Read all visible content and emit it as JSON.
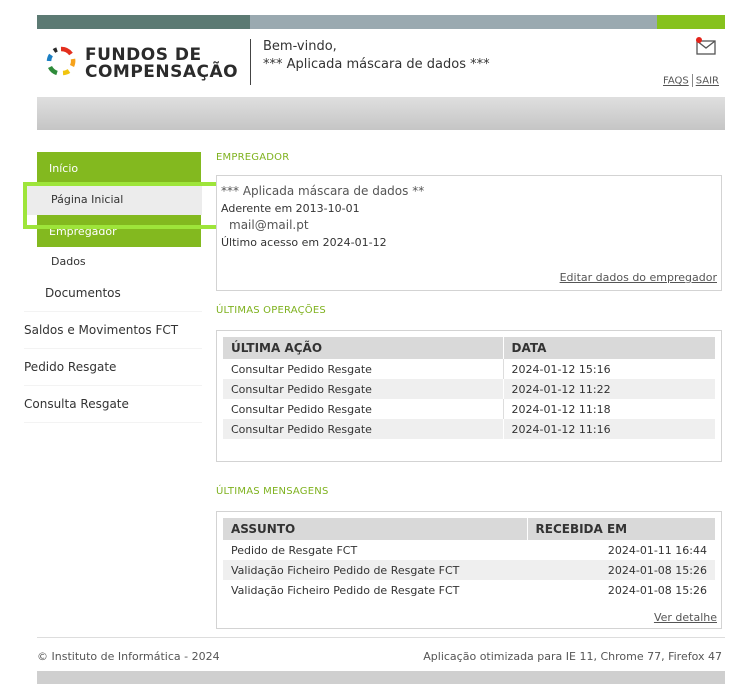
{
  "header": {
    "logo_line1": "FUNDOS DE",
    "logo_line2": "COMPENSAÇÃO",
    "welcome": "Bem-vindo,",
    "user": "*** Aplicada máscara de dados ***",
    "faqs": "FAQS",
    "sair": "SAIR"
  },
  "sidebar": {
    "section1": "Início",
    "pagina_inicial": "Página Inicial",
    "section2": "Empregador",
    "dados": "Dados",
    "items": [
      "Documentos",
      "Saldos e Movimentos FCT",
      "Pedido Resgate",
      "Consulta Resgate"
    ]
  },
  "empregador": {
    "title": "EMPREGADOR",
    "name": "*** Aplicada máscara de dados **",
    "aderente": "Aderente em 2013-10-01",
    "email": "mail@mail.pt",
    "ultimo_acesso": "Último acesso em 2024-01-12",
    "edit_link": "Editar dados do empregador"
  },
  "operacoes": {
    "title": "ÚLTIMAS OPERAÇÕES",
    "col1": "ÚLTIMA AÇÃO",
    "col2": "DATA",
    "rows": [
      {
        "acao": "Consultar Pedido Resgate",
        "data": "2024-01-12 15:16"
      },
      {
        "acao": "Consultar Pedido Resgate",
        "data": "2024-01-12 11:22"
      },
      {
        "acao": "Consultar Pedido Resgate",
        "data": "2024-01-12 11:18"
      },
      {
        "acao": "Consultar Pedido Resgate",
        "data": "2024-01-12 11:16"
      }
    ]
  },
  "mensagens": {
    "title": "ÚLTIMAS MENSAGENS",
    "col1": "ASSUNTO",
    "col2": "RECEBIDA EM",
    "rows": [
      {
        "assunto": "Pedido de Resgate FCT",
        "recebida": "2024-01-11 16:44"
      },
      {
        "assunto": "Validação Ficheiro Pedido de Resgate FCT",
        "recebida": "2024-01-08 15:26"
      },
      {
        "assunto": "Validação Ficheiro Pedido de Resgate FCT",
        "recebida": "2024-01-08 15:26"
      }
    ],
    "ver_detalhe": "Ver detalhe"
  },
  "footer": {
    "left": "© Instituto de Informática - 2024",
    "right": "Aplicação otimizada para IE 11, Chrome 77, Firefox 47"
  },
  "colors": {
    "accent_green": "#83b91f",
    "highlight": "#9ee53a",
    "topbar_dark": "#5c7a73",
    "topbar_grey": "#9aa9b0"
  },
  "icons": [
    "logo-icon",
    "mail-icon"
  ]
}
